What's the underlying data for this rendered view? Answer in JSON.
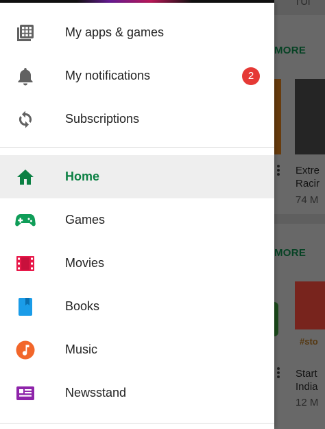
{
  "drawer": {
    "account_items": [
      {
        "label": "My apps & games",
        "icon": "apps-grid-icon"
      },
      {
        "label": "My notifications",
        "icon": "bell-icon",
        "badge": "2"
      },
      {
        "label": "Subscriptions",
        "icon": "refresh-icon"
      }
    ],
    "nav_items": [
      {
        "label": "Home",
        "icon": "home-icon",
        "active": true,
        "color": "#0b8043"
      },
      {
        "label": "Games",
        "icon": "gamepad-icon",
        "color": "#0f9d58"
      },
      {
        "label": "Movies",
        "icon": "film-icon",
        "color": "#e8194a"
      },
      {
        "label": "Books",
        "icon": "book-icon",
        "color": "#1a9ce8"
      },
      {
        "label": "Music",
        "icon": "music-note-icon",
        "color": "#f2662a"
      },
      {
        "label": "Newsstand",
        "icon": "newsstand-icon",
        "color": "#8e24aa"
      }
    ]
  },
  "background": {
    "more_label": "MORE",
    "card1_title": "Extre",
    "card1_title2": "Racir",
    "card1_meta": "74 M",
    "card2_tag": "#sto",
    "card2_title": "Start",
    "card2_title2": "India",
    "card2_meta": "12 M",
    "top_text": "l'Ul"
  }
}
